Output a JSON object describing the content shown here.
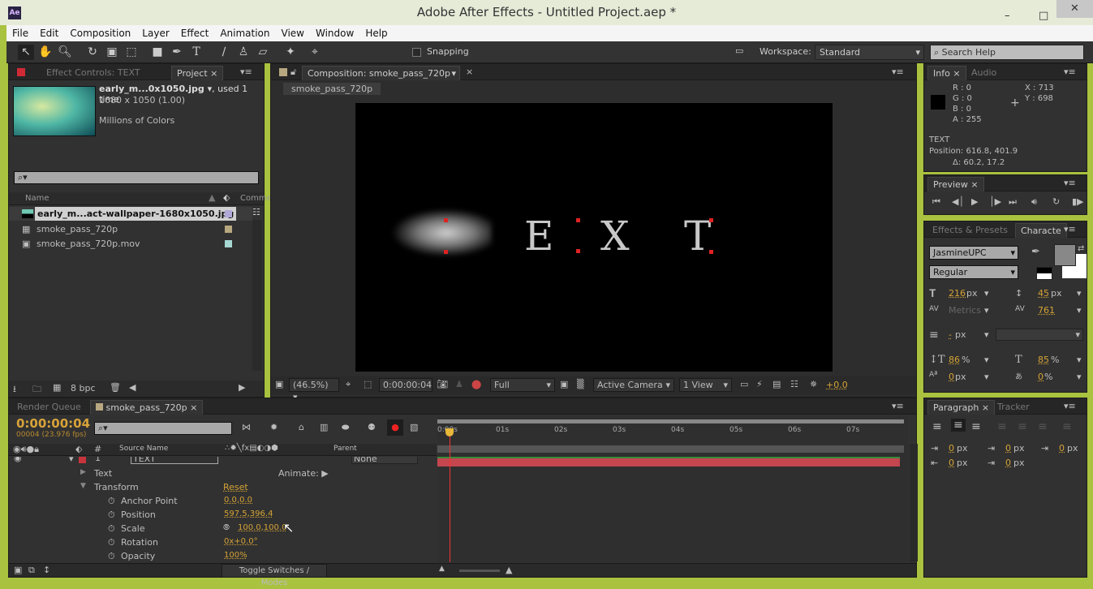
{
  "window": {
    "title": "Adobe After Effects - Untitled Project.aep *",
    "app_icon": "Ae",
    "minimize": "–",
    "maximize": "□",
    "close": "✕"
  },
  "menu": [
    "File",
    "Edit",
    "Composition",
    "Layer",
    "Effect",
    "Animation",
    "View",
    "Window",
    "Help"
  ],
  "toolbar": {
    "snapping": "Snapping",
    "workspace_label": "Workspace:",
    "workspace_value": "Standard",
    "search_placeholder": "Search Help"
  },
  "project": {
    "tab_effect_controls": "Effect Controls: TEXT",
    "tab_project": "Project",
    "file_name": "early_m...0x1050.jpg ▾",
    "used": ", used 1 time",
    "dimensions": "1680 x 1050 (1.00)",
    "colors": "Millions of Colors",
    "col_name": "Name",
    "col_comment": "Comme",
    "items": [
      {
        "name": "early_m...act-wallpaper-1680x1050.jpg",
        "color": "#b0a8d8"
      },
      {
        "name": "smoke_pass_720p",
        "color": "#b8a880"
      },
      {
        "name": "smoke_pass_720p.mov",
        "color": "#a8d8d4"
      }
    ],
    "bpc": "8 bpc"
  },
  "comp": {
    "tab": "Composition: smoke_pass_720p",
    "subtab": "smoke_pass_720p",
    "letters": [
      "E",
      "X",
      "T"
    ],
    "zoom": "(46.5%)",
    "timecode": "0:00:00:04",
    "resolution": "Full",
    "camera": "Active Camera",
    "views": "1 View",
    "exposure": "+0.0"
  },
  "info": {
    "tab": "Info",
    "tab2": "Audio",
    "r": "R : 0",
    "g": "G : 0",
    "b": "B : 0",
    "a": "A : 255",
    "x": "X : 713",
    "y": "Y : 698",
    "layer": "TEXT",
    "position": "Position: 616.8, 401.9",
    "delta": "Δ: 60.2, 17.2"
  },
  "preview": {
    "tab": "Preview"
  },
  "character": {
    "tab_effects": "Effects & Presets",
    "tab_char": "Characte",
    "font": "JasmineUPC",
    "style": "Regular",
    "size": "216",
    "leading": "45",
    "kerning": "Metrics",
    "tracking": "761",
    "stroke": "-",
    "vscale": "86",
    "hscale": "85",
    "baseline": "0",
    "tsume": "0",
    "px": "px",
    "pct": "%"
  },
  "paragraph": {
    "tab": "Paragraph",
    "tab2": "Tracker",
    "values": [
      "0",
      "0",
      "0",
      "0",
      "0"
    ],
    "px": "px"
  },
  "timeline": {
    "tab_render": "Render Queue",
    "tab_comp": "smoke_pass_720p",
    "timecode": "0:00:00:04",
    "frame_info": "00004 (23.976 fps)",
    "col_source": "Source Name",
    "col_parent": "Parent",
    "layer_num": "1",
    "layer_name": "TEXT",
    "parent": "None",
    "ruler": [
      "0:00s",
      "01s",
      "02s",
      "03s",
      "04s",
      "05s",
      "06s",
      "07s"
    ],
    "toggle": "Toggle Switches / Modes",
    "props": [
      {
        "name": "Text",
        "value": "",
        "extra": "Animate:"
      },
      {
        "name": "Transform",
        "value": "Reset"
      },
      {
        "name": "Anchor Point",
        "value": "0.0,0.0"
      },
      {
        "name": "Position",
        "value": "597.5,396.4"
      },
      {
        "name": "Scale",
        "value": "100.0,100.0"
      },
      {
        "name": "Rotation",
        "value": "0x+0.0°"
      },
      {
        "name": "Opacity",
        "value": "100%"
      }
    ]
  }
}
